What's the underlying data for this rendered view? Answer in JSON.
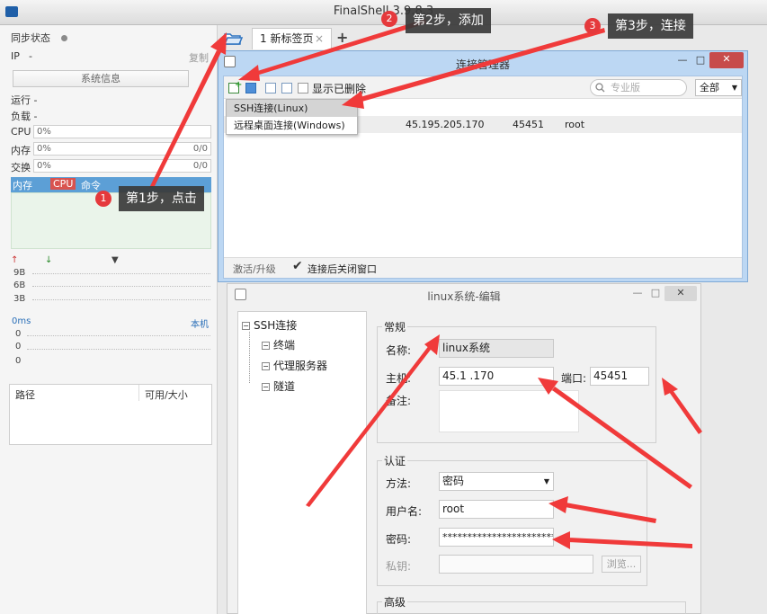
{
  "app": {
    "title": "FinalShell 3.9.8.3"
  },
  "left_panel": {
    "sync_label": "同步状态",
    "ip_label": "IP",
    "ip_value": "-",
    "copy_label": "复制",
    "sysinfo_button": "系统信息",
    "running_label": "运行 -",
    "load_label": "负载 -",
    "cpu_label": "CPU",
    "cpu_value": "0%",
    "mem_label": "内存",
    "mem_value": "0%",
    "mem_right": "0/0",
    "swap_label": "交换",
    "swap_value": "0%",
    "swap_right": "0/0",
    "monitor_tabs": [
      "内存",
      "CPU",
      "命令"
    ],
    "net_scale": [
      "9B",
      "6B",
      "3B"
    ],
    "ping_label": "0ms",
    "ping_target": "本机",
    "ping_values": [
      "0",
      "0",
      "0"
    ],
    "files_path_label": "路径",
    "files_size_label": "可用/大小"
  },
  "tabs": {
    "items": [
      {
        "label": "1 新标签页",
        "close": "×"
      }
    ],
    "add": "+"
  },
  "connection_manager": {
    "title": "连接管理器",
    "show_deleted": "显示已删除",
    "search_placeholder": "专业版",
    "filter_value": "全部",
    "add_menu": [
      "SSH连接(Linux)",
      "远程桌面连接(Windows)"
    ],
    "row": {
      "host": "45.195.205.170",
      "port": "45451",
      "user": "root"
    },
    "upgrade_label": "激活/升级",
    "close_after_connect": "连接后关闭窗口",
    "close_after_connect_checked": true
  },
  "editor": {
    "title": "linux系统-编辑",
    "tree": {
      "root": "SSH连接",
      "children": [
        "终端",
        "代理服务器",
        "隧道"
      ]
    },
    "general_group": "常规",
    "name_label": "名称:",
    "name_value": "linux系统",
    "host_label": "主机:",
    "host_value": "45.1        .170",
    "port_label": "端口:",
    "port_value": "45451",
    "notes_label": "备注:",
    "auth_group": "认证",
    "method_label": "方法:",
    "method_value": "密码",
    "user_label": "用户名:",
    "user_value": "root",
    "password_label": "密码:",
    "password_value": "************************",
    "key_label": "私钥:",
    "browse_button": "浏览...",
    "advanced_group": "高级"
  },
  "callouts": [
    {
      "num": "1",
      "text": "第1步，点击"
    },
    {
      "num": "2",
      "text": "第2步，添加"
    },
    {
      "num": "3",
      "text": "第3步，连接"
    }
  ],
  "colors": {
    "arrow_red": "#f03a3a",
    "badge_red": "#e5393c",
    "callout_bg": "#3a3a3a",
    "selection_blue": "#5c9fd6"
  }
}
